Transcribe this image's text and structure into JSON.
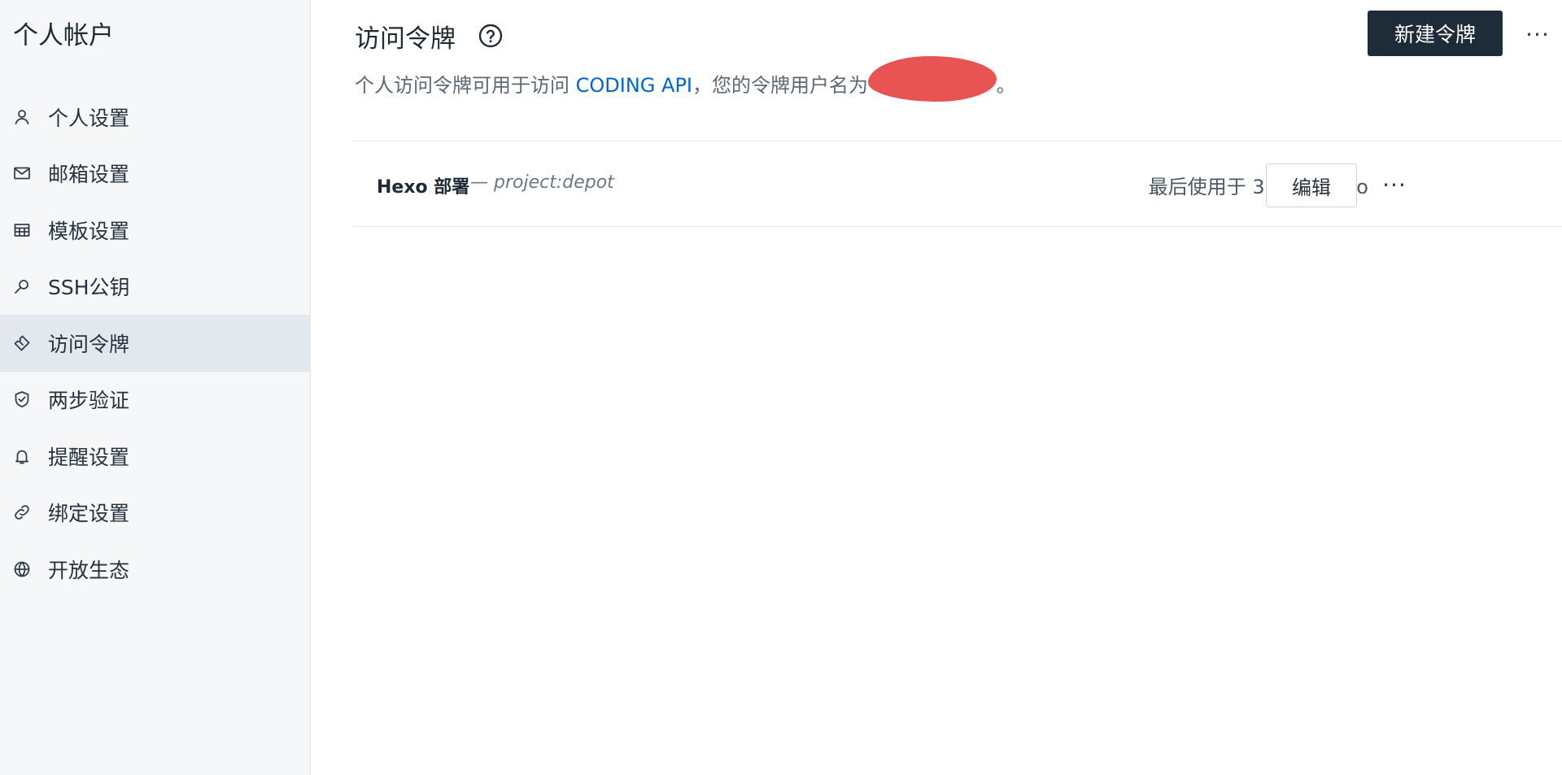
{
  "sidebar": {
    "title": "个人帐户",
    "items": [
      {
        "label": "个人设置",
        "icon": "user-icon",
        "active": false
      },
      {
        "label": "邮箱设置",
        "icon": "mail-icon",
        "active": false
      },
      {
        "label": "模板设置",
        "icon": "table-icon",
        "active": false
      },
      {
        "label": "SSH公钥",
        "icon": "key-icon",
        "active": false
      },
      {
        "label": "访问令牌",
        "icon": "ticket-icon",
        "active": true
      },
      {
        "label": "两步验证",
        "icon": "shield-check-icon",
        "active": false
      },
      {
        "label": "提醒设置",
        "icon": "bell-icon",
        "active": false
      },
      {
        "label": "绑定设置",
        "icon": "link-icon",
        "active": false
      },
      {
        "label": "开放生态",
        "icon": "globe-icon",
        "active": false
      }
    ]
  },
  "header": {
    "title": "访问令牌",
    "help_icon": "help-circle-icon",
    "new_token_label": "新建令牌",
    "more_label": "···"
  },
  "description": {
    "prefix": "个人访问令牌可用于访问 ",
    "link_text": "CODING API",
    "middle": "，您的令牌用户名为 ",
    "suffix": "。"
  },
  "tokens": [
    {
      "name": "Hexo 部署",
      "scope": "— project:depot",
      "last_used": "最后使用于 3 hours ago",
      "edit_label": "编辑",
      "more_label": "···"
    }
  ],
  "colors": {
    "sidebar_bg": "#f5f7f9",
    "active_item_bg": "#e3e8ef",
    "primary_button": "#1e2b38",
    "link": "#0066cc",
    "redaction": "#e85451"
  }
}
